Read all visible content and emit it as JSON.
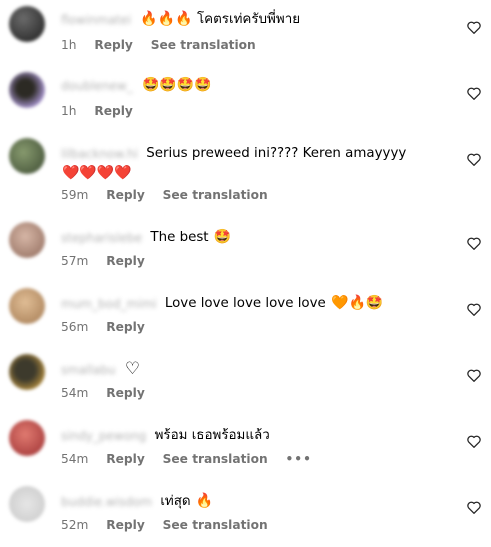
{
  "comments": [
    {
      "username": "flowinmatei",
      "text": "โคตรเท่ครับพี่พาย",
      "emoji_before": "🔥🔥🔥",
      "emoji_after": "",
      "time": "1h",
      "reply": "Reply",
      "translate": "See translation",
      "more": "",
      "avatar_color": "#2f2f2f"
    },
    {
      "username": "doublenew_",
      "text": "",
      "emoji_before": "🤩🤩🤩🤩",
      "emoji_after": "",
      "time": "1h",
      "reply": "Reply",
      "translate": "",
      "more": "",
      "avatar_color": "#5a3f2f"
    },
    {
      "username": "lilbacknow.hi",
      "text": "Serius preweed ini???? Keren amayyyy",
      "emoji_before": "",
      "emoji_after": "❤️❤️❤️❤️",
      "time": "59m",
      "reply": "Reply",
      "translate": "See translation",
      "more": "",
      "avatar_color": "#5d6b4a"
    },
    {
      "username": "stepharislebe",
      "text": "The best",
      "emoji_before": "",
      "emoji_after": "🤩",
      "time": "57m",
      "reply": "Reply",
      "translate": "",
      "more": "",
      "avatar_color": "#b38f80"
    },
    {
      "username": "mum_bod_mimi",
      "text": "Love love love love love",
      "emoji_before": "",
      "emoji_after": "🧡🔥🤩",
      "time": "56m",
      "reply": "Reply",
      "translate": "",
      "more": "",
      "avatar_color": "#c49a6c"
    },
    {
      "username": "smallabu",
      "text": "",
      "emoji_before": "♡",
      "emoji_after": "",
      "time": "54m",
      "reply": "Reply",
      "translate": "",
      "more": "",
      "avatar_color": "#3a3a30"
    },
    {
      "username": "sindy_pewong",
      "text": "พร้อม เธอพร้อมแล้ว",
      "emoji_before": "",
      "emoji_after": "",
      "time": "54m",
      "reply": "Reply",
      "translate": "See translation",
      "more": "•••",
      "avatar_color": "#c4484a"
    },
    {
      "username": "buddie.wisdom",
      "text": "เท่สุด",
      "emoji_before": "",
      "emoji_after": "🔥",
      "time": "52m",
      "reply": "Reply",
      "translate": "See translation",
      "more": "",
      "avatar_color": "#cfcfcf"
    }
  ]
}
